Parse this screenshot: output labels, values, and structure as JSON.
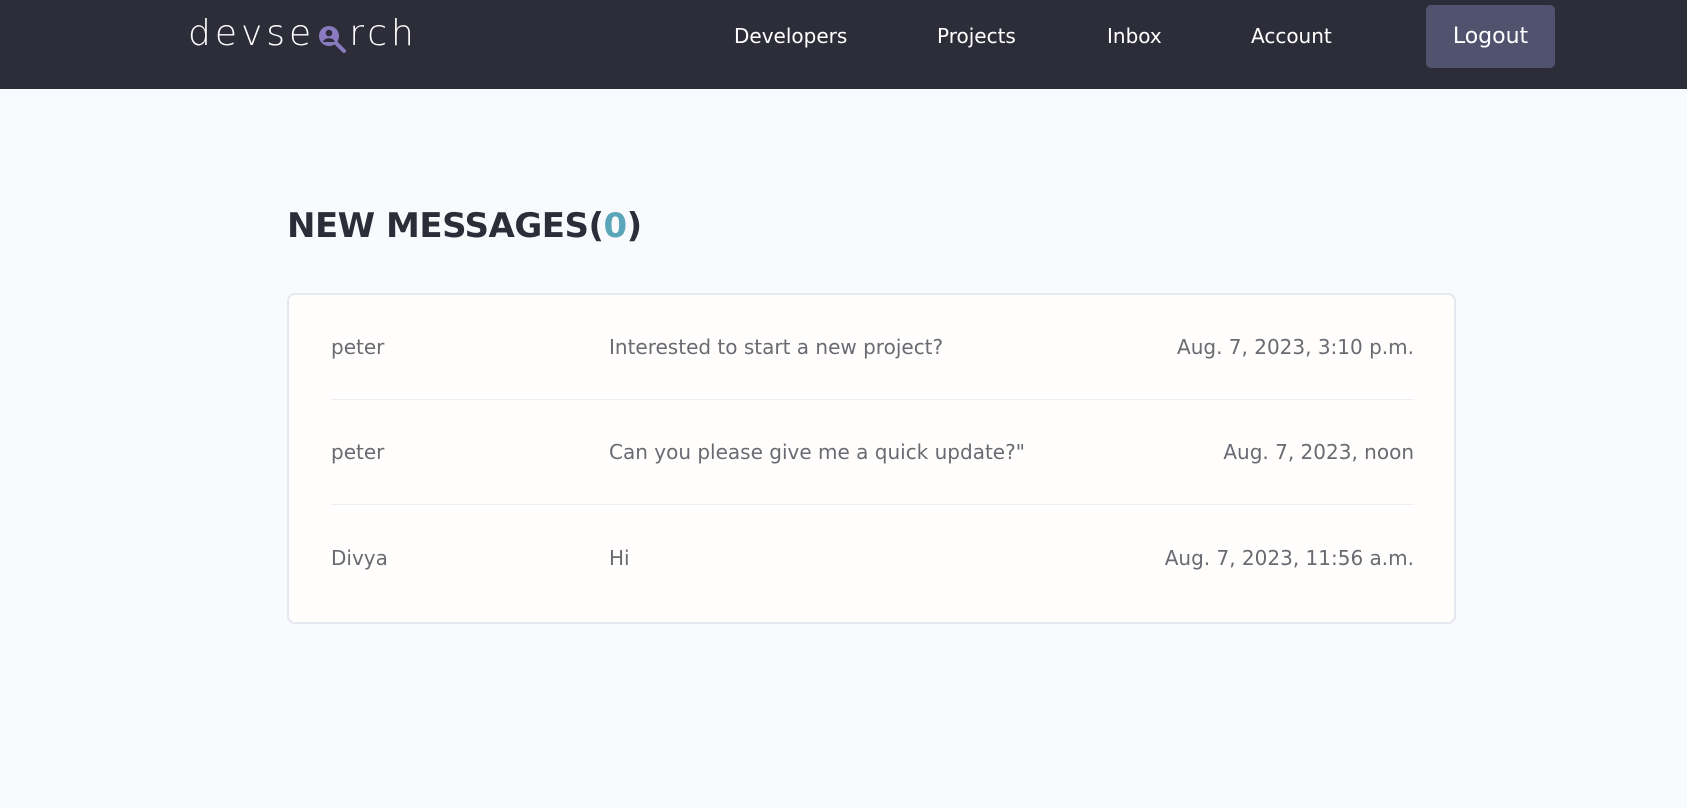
{
  "header": {
    "logo": {
      "prefix": "devse",
      "suffix": "rch",
      "icon": "magnifier-person-icon"
    },
    "nav": [
      {
        "label": "Developers"
      },
      {
        "label": "Projects"
      },
      {
        "label": "Inbox"
      },
      {
        "label": "Account"
      }
    ],
    "logout_label": "Logout"
  },
  "main": {
    "title_prefix": "NEW MESSAGES(",
    "new_count": "0",
    "title_suffix": ")",
    "messages": [
      {
        "sender": "peter",
        "subject": "Interested to start a new project?",
        "date": "Aug. 7, 2023, 3:10 p.m."
      },
      {
        "sender": "peter",
        "subject": "Can you please give me a quick update?\"",
        "date": "Aug. 7, 2023, noon"
      },
      {
        "sender": "Divya",
        "subject": "Hi",
        "date": "Aug. 7, 2023, 11:56 a.m."
      }
    ]
  },
  "colors": {
    "header_bg": "#2d2d39",
    "page_bg": "#f8fafd",
    "accent": "#5aa5b9",
    "logout_bg": "#51526e",
    "logo_icon": "#8a7bc0"
  }
}
